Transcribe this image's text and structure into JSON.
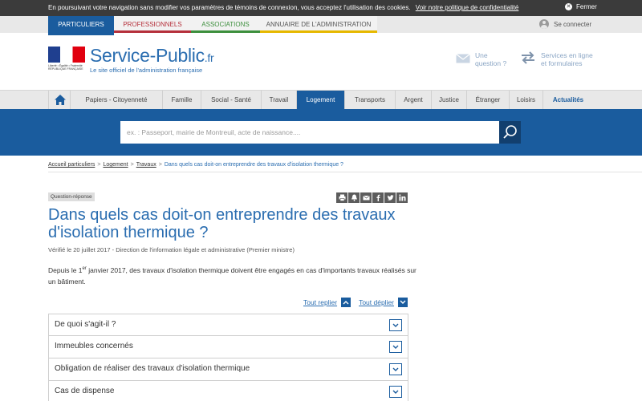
{
  "cookie_bar": {
    "message": "En poursuivant votre navigation sans modifier vos paramètres de témoins de connexion, vous acceptez l'utilisation des cookies.",
    "link": "Voir notre politique de confidentialité",
    "close": "Fermer"
  },
  "audience_tabs": [
    "PARTICULIERS",
    "PROFESSIONNELS",
    "ASSOCIATIONS",
    "ANNUAIRE DE L'ADMINISTRATION"
  ],
  "connect_label": "Se connecter",
  "logo": {
    "name": "Service-Public",
    "suffix": ".fr",
    "tagline": "Le site officiel de l'administration française",
    "marianne_caption": "Liberté • Égalité • Fraternité RÉPUBLIQUE FRANÇAISE"
  },
  "header_links": {
    "question_line1": "Une",
    "question_line2": "question ?",
    "services_line1": "Services en ligne",
    "services_line2": "et formulaires"
  },
  "main_nav": [
    "Papiers - Citoyenneté",
    "Famille",
    "Social - Santé",
    "Travail",
    "Logement",
    "Transports",
    "Argent",
    "Justice",
    "Étranger",
    "Loisirs",
    "Actualités"
  ],
  "search": {
    "placeholder": "ex. : Passeport, mairie de Montreuil, acte de naissance...."
  },
  "breadcrumb": {
    "items": [
      "Accueil particuliers",
      "Logement",
      "Travaux"
    ],
    "current": "Dans quels cas doit-on entreprendre des travaux d'isolation thermique ?"
  },
  "article": {
    "badge": "Question-réponse",
    "title": "Dans quels cas doit-on entreprendre des travaux d'isolation thermique ?",
    "verified": "Vérifié le 20 juillet 2017 - Direction de l'information légale et administrative (Premier ministre)",
    "intro_before": "Depuis le 1",
    "intro_sup": "er",
    "intro_after": " janvier 2017, des travaux d'isolation thermique doivent être engagés en cas d'importants travaux réalisés sur un bâtiment.",
    "collapse_all": "Tout replier",
    "expand_all": "Tout déplier",
    "sections": [
      "De quoi s'agit-il ?",
      "Immeubles concernés",
      "Obligation de réaliser des travaux d'isolation thermique",
      "Cas de dispense"
    ]
  },
  "share_icons": [
    "print-icon",
    "bell-icon",
    "mail-icon",
    "facebook-icon",
    "twitter-icon",
    "linkedin-icon"
  ],
  "colors": {
    "primary": "#1a5c9e",
    "title": "#2a6db0",
    "pro": "#b5303b",
    "asso": "#3d8f3d",
    "annuaire": "#e6b800"
  }
}
